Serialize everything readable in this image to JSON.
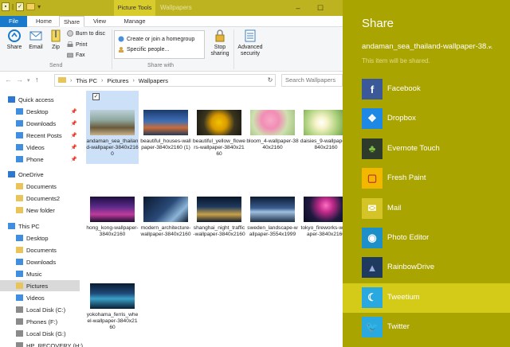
{
  "titlebar": {
    "context_tab": "Picture Tools",
    "title": "Wallpapers"
  },
  "tabs": [
    "File",
    "Home",
    "Share",
    "View",
    "Manage"
  ],
  "ribbon": {
    "share_label": "Share",
    "email_label": "Email",
    "zip_label": "Zip",
    "burn_label": "Burn to disc",
    "print_label": "Print",
    "fax_label": "Fax",
    "send_group": "Send",
    "homegroup_label": "Create or join a homegroup",
    "specific_people_label": "Specific people...",
    "share_with_group": "Share with",
    "stop_sharing_label": "Stop sharing",
    "advanced_security_label": "Advanced security"
  },
  "address": {
    "crumbs": [
      "This PC",
      "Pictures",
      "Wallpapers"
    ],
    "search_placeholder": "Search Wallpapers"
  },
  "nav": {
    "items": [
      {
        "label": "Quick access",
        "pinned": false
      },
      {
        "label": "Desktop",
        "pinned": true
      },
      {
        "label": "Downloads",
        "pinned": true
      },
      {
        "label": "Recent Posts",
        "pinned": true
      },
      {
        "label": "Videos",
        "pinned": true
      },
      {
        "label": "Phone",
        "pinned": true
      },
      {
        "label": "OneDrive",
        "pinned": false
      },
      {
        "label": "Documents",
        "pinned": false
      },
      {
        "label": "Documents2",
        "pinned": false
      },
      {
        "label": "New folder",
        "pinned": false
      },
      {
        "label": "This PC",
        "pinned": false
      },
      {
        "label": "Desktop",
        "pinned": false
      },
      {
        "label": "Documents",
        "pinned": false
      },
      {
        "label": "Downloads",
        "pinned": false
      },
      {
        "label": "Music",
        "pinned": false
      },
      {
        "label": "Pictures",
        "pinned": false
      },
      {
        "label": "Videos",
        "pinned": false
      },
      {
        "label": "Local Disk (C:)",
        "pinned": false
      },
      {
        "label": "Phones (F:)",
        "pinned": false
      },
      {
        "label": "Local Disk (G:)",
        "pinned": false
      },
      {
        "label": "HP_RECOVERY (H:)",
        "pinned": false
      }
    ],
    "pin_glyph": "📌"
  },
  "files": [
    {
      "name": "andaman_sea_thailand-wallpaper-3840x2160",
      "selected": true
    },
    {
      "name": "beautiful_houses-wallpaper-3840x2160 (1)",
      "selected": false
    },
    {
      "name": "beautiful_yellow_flowers-wallpaper-3840x2160",
      "selected": false
    },
    {
      "name": "bloom_4-wallpaper-3840x2160",
      "selected": false
    },
    {
      "name": "daisies_9-wallpaper-3840x2160",
      "selected": false
    },
    {
      "name": "hong_kong-wallpaper-3840x2160",
      "selected": false
    },
    {
      "name": "modern_architecture-wallpaper-3840x2160",
      "selected": false
    },
    {
      "name": "shanghai_night_traffic-wallpaper-3840x2160",
      "selected": false
    },
    {
      "name": "sweden_landscape-wallpaper-3554x1999",
      "selected": false
    },
    {
      "name": "tokyo_fireworks-wallpaper-3840x2160",
      "selected": false
    },
    {
      "name": "yokohama_ferris_wheel-wallpaper-3840x2160",
      "selected": false
    }
  ],
  "share_pane": {
    "title": "Share",
    "file": "andaman_sea_thailand-wallpaper-38...",
    "subtitle": "This item will be shared.",
    "apps": [
      {
        "label": "Facebook",
        "icon": "facebook-icon",
        "highlight": false
      },
      {
        "label": "Dropbox",
        "icon": "dropbox-icon",
        "highlight": false
      },
      {
        "label": "Evernote Touch",
        "icon": "evernote-icon",
        "highlight": false
      },
      {
        "label": "Fresh Paint",
        "icon": "fresh-paint-icon",
        "highlight": false
      },
      {
        "label": "Mail",
        "icon": "mail-icon",
        "highlight": false
      },
      {
        "label": "Photo Editor",
        "icon": "photo-editor-icon",
        "highlight": false
      },
      {
        "label": "RainbowDrive",
        "icon": "rainbowdrive-icon",
        "highlight": false
      },
      {
        "label": "Tweetium",
        "icon": "tweetium-icon",
        "highlight": true
      },
      {
        "label": "Twitter",
        "icon": "twitter-icon",
        "highlight": false
      }
    ]
  },
  "colors": {
    "accent": "#bdb220",
    "share_bg": "#aaa400",
    "share_highlight": "#d4ca18",
    "file_tab": "#1979ca",
    "selection": "#cce0f7"
  }
}
